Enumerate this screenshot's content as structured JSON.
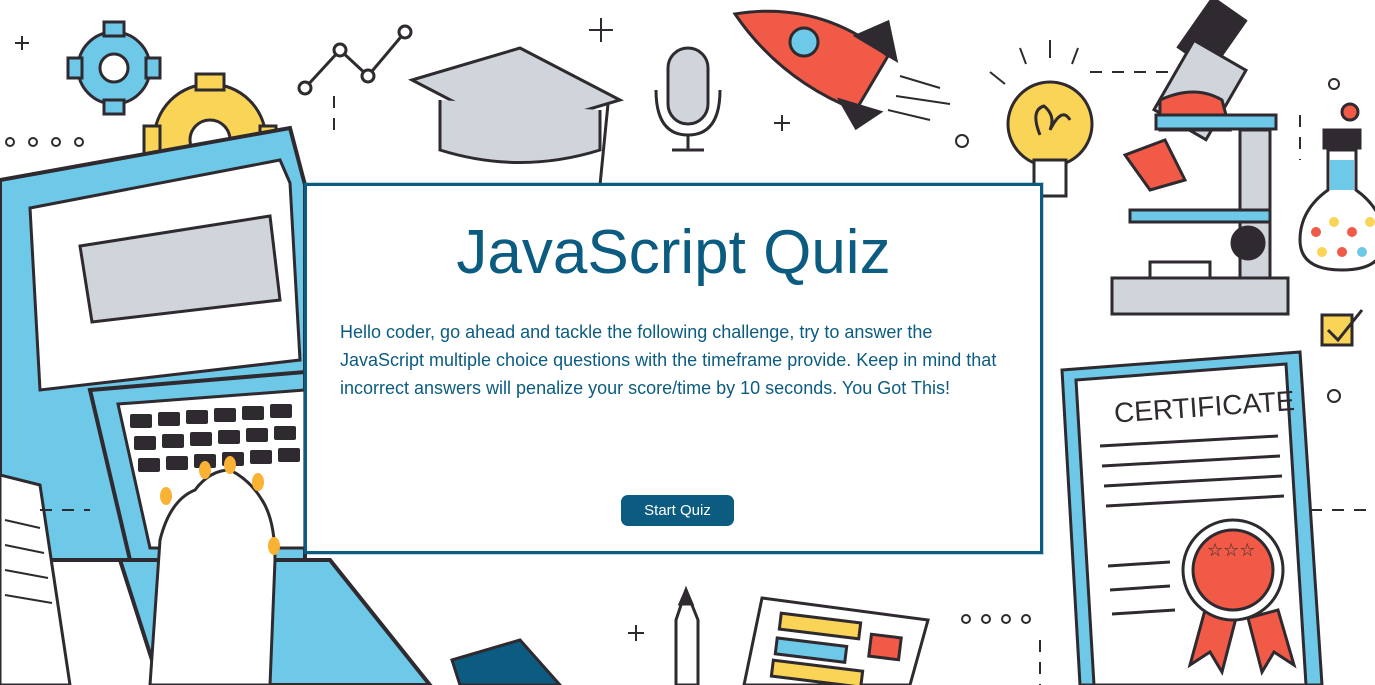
{
  "quiz": {
    "title": "JavaScript Quiz",
    "intro": "Hello coder, go ahead and tackle the following challenge, try to answer the JavaScript multiple choice questions with the timeframe provide. Keep in mind that incorrect answers will penalize your score/time by 10 seconds. You Got This!",
    "start_label": "Start Quiz"
  },
  "background": {
    "certificate_label": "CERTIFICATE",
    "icons": [
      "gear-icon",
      "gear-icon",
      "line-chart-icon",
      "graduation-cap-icon",
      "microphone-icon",
      "rocket-icon",
      "lightbulb-icon",
      "microscope-icon",
      "flask-icon",
      "checkbox-icon",
      "laptop-icon",
      "hand-icon",
      "certificate-icon",
      "award-ribbon-icon",
      "pencil-icon",
      "clipboard-icon"
    ]
  },
  "colors": {
    "primary": "#0b5c80",
    "illustration_blue": "#6ec8e8",
    "illustration_yellow": "#f9d457",
    "illustration_red": "#f05a46",
    "illustration_dark": "#2f2a2f",
    "illustration_gray": "#d0d4db"
  }
}
